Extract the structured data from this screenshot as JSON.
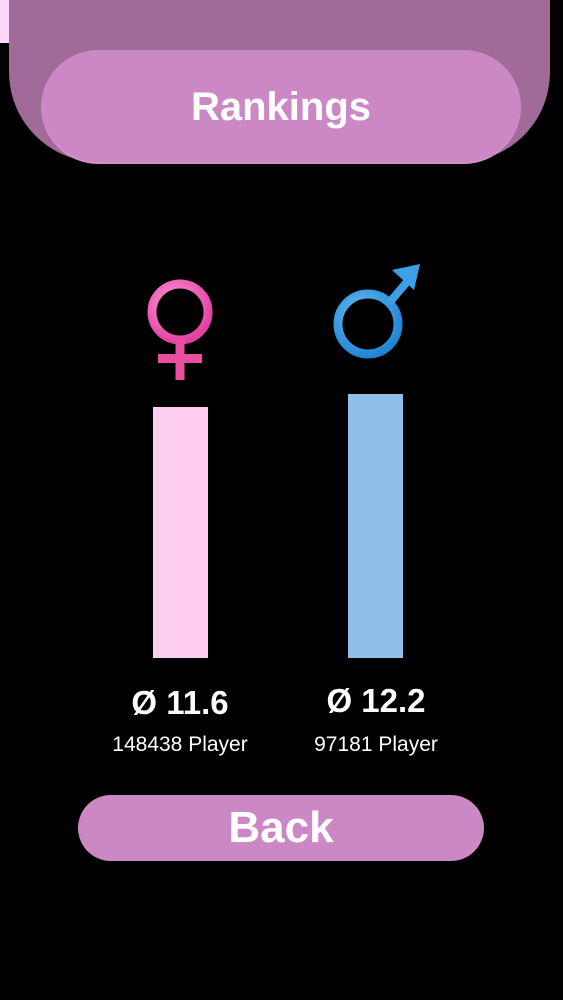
{
  "header": {
    "title": "Rankings"
  },
  "rankings": {
    "female": {
      "icon": "female-symbol-icon",
      "color": "#ff6ec7",
      "bar_color": "#ffcdee",
      "average_label": "Ø 11.6",
      "average": 11.6,
      "players_label": "148438 Player"
    },
    "male": {
      "icon": "male-symbol-icon",
      "color": "#3ca0e6",
      "bar_color": "#8fc0ec",
      "average_label": "Ø 12.2",
      "average": 12.2,
      "players_label": "97181 Player"
    }
  },
  "footer": {
    "back_label": "Back"
  },
  "colors": {
    "background": "#000000",
    "accent": "#cc88c5",
    "header_shadow": "#a06b99",
    "status_strip": "#fdd8fb"
  }
}
